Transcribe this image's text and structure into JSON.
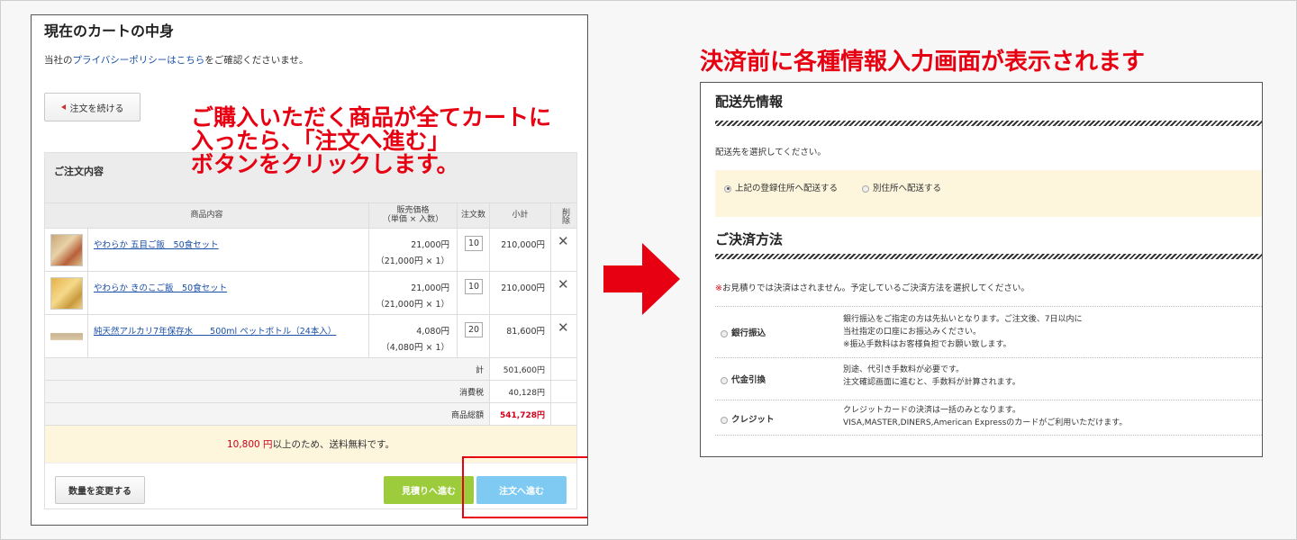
{
  "left_panel": {
    "title": "現在のカートの中身",
    "privacy_prefix": "当社の",
    "privacy_link": "プライバシーポリシーはこちら",
    "privacy_suffix": "をご確認くださいませ。",
    "continue_button": "注文を続ける",
    "order_header": "ご注文内容",
    "columns": {
      "product": "商品内容",
      "price": "販売価格\n（単価 × 入数）",
      "qty": "注文数",
      "subtotal": "小計",
      "delete": "削除"
    },
    "items": [
      {
        "name": "やわらか 五目ご飯　50食セット",
        "price": "21,000円",
        "unit": "（21,000円 × 1）",
        "qty": "10",
        "subtotal": "210,000円",
        "thumb_icon": "rice-product-thumbnail"
      },
      {
        "name": "やわらか きのこご飯　50食セット",
        "price": "21,000円",
        "unit": "（21,000円 × 1）",
        "qty": "10",
        "subtotal": "210,000円",
        "thumb_icon": "mushroom-rice-thumbnail"
      },
      {
        "name": "純天然アルカリ7年保存水　　500ml ペットボトル（24本入）",
        "price": "4,080円",
        "unit": "（4,080円 × 1）",
        "qty": "20",
        "subtotal": "81,600円",
        "thumb_icon": "water-bottle-thumbnail"
      }
    ],
    "summary": [
      {
        "label": "計",
        "value": "501,600円"
      },
      {
        "label": "消費税",
        "value": "40,128円"
      },
      {
        "label": "商品総額",
        "value": "541,728円"
      }
    ],
    "free_shipping_amount": "10,800 円",
    "free_shipping_text": "以上のため、送料無料です。",
    "change_qty_button": "数量を変更する",
    "quote_button": "見積りへ進む",
    "order_button": "注文へ進む",
    "delete_icon": "close-icon"
  },
  "callout": {
    "line1": "ご購入いただく商品が全てカートに",
    "line2": "入ったら、「注文へ進む」",
    "line3": "ボタンをクリックします。"
  },
  "right_heading": "決済前に各種情報入力画面が表示されます",
  "right_panel": {
    "shipping_title": "配送先情報",
    "shipping_prompt": "配送先を選択してください。",
    "address_options": [
      "上記の登録住所へ配送する",
      "別住所へ配送する"
    ],
    "payment_title": "ご決済方法",
    "payment_note_mark": "※",
    "payment_note": "お見積りでは決済はされません。予定しているご決済方法を選択してください。",
    "payment_methods": [
      {
        "label": "銀行振込",
        "desc": [
          "銀行振込をご指定の方は先払いとなります。ご注文後、7日以内に",
          "当社指定の口座にお振込みください。",
          "※振込手数料はお客様負担でお願い致します。"
        ]
      },
      {
        "label": "代金引換",
        "desc": [
          "別途、代引き手数料が必要です。",
          "注文確認画面に進むと、手数料が計算されます。"
        ]
      },
      {
        "label": "クレジット",
        "desc": [
          "クレジットカードの決済は一括のみとなります。",
          "VISA,MASTER,DINERS,American Expressのカードがご利用いただけます。"
        ]
      }
    ]
  },
  "colors": {
    "accent_red": "#e60012",
    "link_blue": "#1a4fa8",
    "quote_green": "#9ccc3c",
    "order_blue": "#7ecaf2",
    "highlight_bg": "#fdf5dc"
  }
}
